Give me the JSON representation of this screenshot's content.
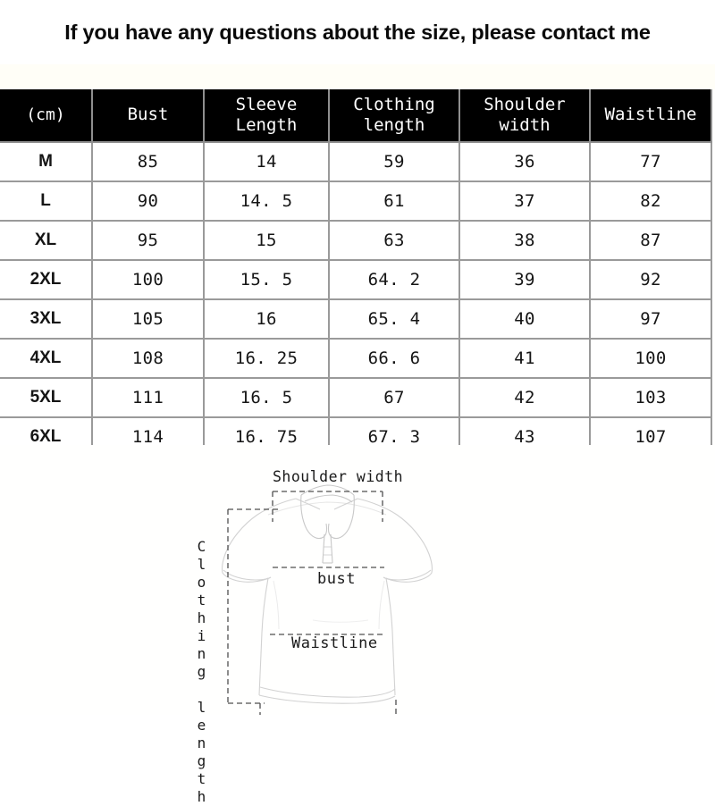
{
  "title": "If you have any questions about the size, please contact me",
  "table": {
    "columns": [
      "(cm)",
      "Bust",
      "Sleeve Length",
      "Clothing length",
      "Shoulder width",
      "Waistline"
    ],
    "rows": [
      {
        "size": "M",
        "bust": "85",
        "sleeve_length": "14",
        "clothing_length": "59",
        "shoulder_width": "36",
        "waistline": "77"
      },
      {
        "size": "L",
        "bust": "90",
        "sleeve_length": "14. 5",
        "clothing_length": "61",
        "shoulder_width": "37",
        "waistline": "82"
      },
      {
        "size": "XL",
        "bust": "95",
        "sleeve_length": "15",
        "clothing_length": "63",
        "shoulder_width": "38",
        "waistline": "87"
      },
      {
        "size": "2XL",
        "bust": "100",
        "sleeve_length": "15. 5",
        "clothing_length": "64. 2",
        "shoulder_width": "39",
        "waistline": "92"
      },
      {
        "size": "3XL",
        "bust": "105",
        "sleeve_length": "16",
        "clothing_length": "65. 4",
        "shoulder_width": "40",
        "waistline": "97"
      },
      {
        "size": "4XL",
        "bust": "108",
        "sleeve_length": "16. 25",
        "clothing_length": "66. 6",
        "shoulder_width": "41",
        "waistline": "100"
      },
      {
        "size": "5XL",
        "bust": "111",
        "sleeve_length": "16. 5",
        "clothing_length": "67",
        "shoulder_width": "42",
        "waistline": "103"
      },
      {
        "size": "6XL",
        "bust": "114",
        "sleeve_length": "16. 75",
        "clothing_length": "67. 3",
        "shoulder_width": "43",
        "waistline": "107"
      }
    ]
  },
  "diagram": {
    "garment": "polo-shirt-outline",
    "labels": {
      "shoulder_width": "Shoulder width",
      "bust": "bust",
      "waistline": "Waistline",
      "clothing_length": "Clothing length"
    }
  },
  "colors": {
    "header_background": "#000000",
    "header_text": "#ffffff",
    "table_border": "#9a9a9a",
    "body_text": "#151515",
    "page_background": "#ffffff",
    "diagram_line": "#cfcfcf",
    "diagram_guide": "#4a4a4a"
  }
}
